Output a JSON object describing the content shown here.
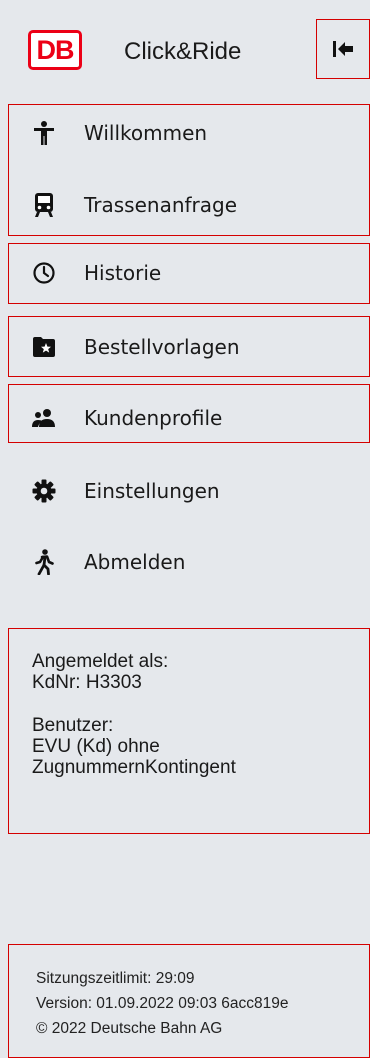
{
  "header": {
    "logo_text": "DB",
    "app_title": "Click&Ride",
    "collapse_icon": "collapse-left-icon"
  },
  "nav": {
    "items": [
      {
        "label": "Willkommen",
        "icon": "person-standing-icon"
      },
      {
        "label": "Trassenanfrage",
        "icon": "train-icon"
      },
      {
        "label": "Historie",
        "icon": "clock-icon"
      },
      {
        "label": "Bestellvorlagen",
        "icon": "folder-star-icon"
      },
      {
        "label": "Kundenprofile",
        "icon": "users-icon"
      },
      {
        "label": "Einstellungen",
        "icon": "gear-icon"
      },
      {
        "label": "Abmelden",
        "icon": "walking-person-icon"
      }
    ]
  },
  "session": {
    "logged_in_label": "Angemeldet als:",
    "customer_number": "KdNr: H3303",
    "user_label": "Benutzer:",
    "user_line1": "EVU (Kd) ohne",
    "user_line2": "ZugnummernKontingent"
  },
  "footer": {
    "session_limit": "Sitzungszeitlimit: 29:09",
    "version": "Version: 01.09.2022 09:03 6acc819e",
    "copyright": "© 2022 Deutsche Bahn AG"
  },
  "colors": {
    "background": "#e5e8ec",
    "db_red": "#ec0016",
    "outline_red": "#d40000",
    "text": "#1a1a1a"
  }
}
